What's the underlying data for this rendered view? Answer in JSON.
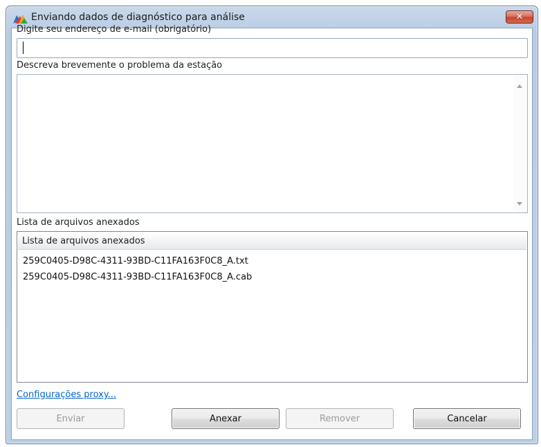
{
  "window": {
    "title": "Enviando dados de diagnóstico para análise",
    "close_glyph": "✕"
  },
  "email": {
    "label": "Digite seu endereço de e-mail (obrigatório)",
    "value": "",
    "placeholder": ""
  },
  "description": {
    "label": "Descreva brevemente o problema da estação",
    "value": ""
  },
  "attachments": {
    "label": "Lista de arquivos anexados",
    "column_header": "Lista de arquivos anexados",
    "files": [
      "259C0405-D98C-4311-93BD-C11FA163F0C8_A.txt",
      "259C0405-D98C-4311-93BD-C11FA163F0C8_A.cab"
    ]
  },
  "proxy_link": "Configurações proxy...",
  "buttons": {
    "send": "Enviar",
    "attach": "Anexar",
    "remove": "Remover",
    "cancel": "Cancelar"
  },
  "colors": {
    "link": "#0066cc",
    "disabled_text": "#9a9a9a",
    "close_red": "#c6452f"
  },
  "icons": {
    "app": "avg-logo-icon",
    "close": "close-icon",
    "scroll_up": "scroll-up-arrow-icon",
    "scroll_down": "scroll-down-arrow-icon"
  }
}
